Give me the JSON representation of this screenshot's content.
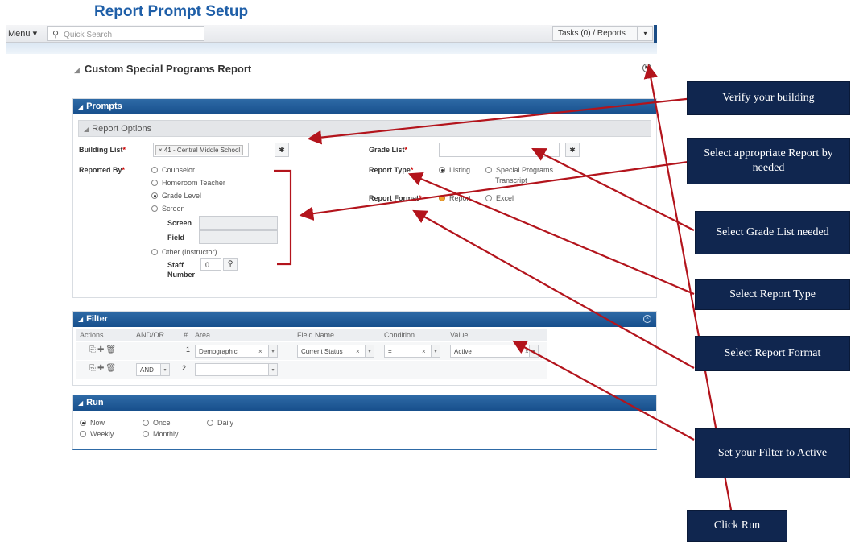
{
  "page_title": "Report Prompt Setup",
  "topbar": {
    "menu_label": "Menu ▾",
    "search_placeholder": "Quick Search",
    "tasks_label": "Tasks (0) / Reports",
    "tasks_dropdown": "▾"
  },
  "report": {
    "title": "Custom Special Programs Report"
  },
  "prompts": {
    "header": "Prompts",
    "subheader": "Report Options",
    "building_list_label": "Building List",
    "building_tag_x": "×",
    "building_tag": "41 - Central Middle School",
    "grade_list_label": "Grade List",
    "picker_symbol": "✱",
    "reported_by_label": "Reported By",
    "reported_by_options": [
      "Counselor",
      "Homeroom Teacher",
      "Grade Level",
      "Screen"
    ],
    "screen_label": "Screen",
    "field_label": "Field",
    "other_option": "Other (Instructor)",
    "staff_number_label_1": "Staff",
    "staff_number_label_2": "Number",
    "staff_number_value": "0",
    "report_type_label": "Report Type",
    "report_type_options": [
      "Listing",
      "Special Programs",
      "Transcript"
    ],
    "report_format_label": "Report Format",
    "report_format_options": [
      "Report",
      "Excel"
    ],
    "required_mark": "*"
  },
  "filter": {
    "header": "Filter",
    "columns": [
      "Actions",
      "AND/OR",
      "#",
      "Area",
      "Field Name",
      "Condition",
      "Value"
    ],
    "rows": [
      {
        "num": "1",
        "andor": "",
        "area": "Demographic",
        "field": "Current Status",
        "condition": "=",
        "value": "Active"
      },
      {
        "num": "2",
        "andor": "AND",
        "area": "",
        "field": "",
        "condition": "",
        "value": ""
      }
    ],
    "clear_symbol": "×",
    "dropdown_symbol": "▾"
  },
  "run": {
    "header": "Run",
    "options": [
      "Now",
      "Once",
      "Daily",
      "Weekly",
      "Monthly"
    ]
  },
  "callouts": [
    "Verify your building",
    "Select appropriate Report by needed",
    "Select Grade List needed",
    "Select Report Type",
    "Select Report Format",
    "Set your Filter to Active",
    "Click Run"
  ],
  "colors": {
    "section_header": "#174f8c",
    "callout_bg": "#10264f",
    "arrow": "#b3141c",
    "page_title": "#1f5fa8"
  }
}
